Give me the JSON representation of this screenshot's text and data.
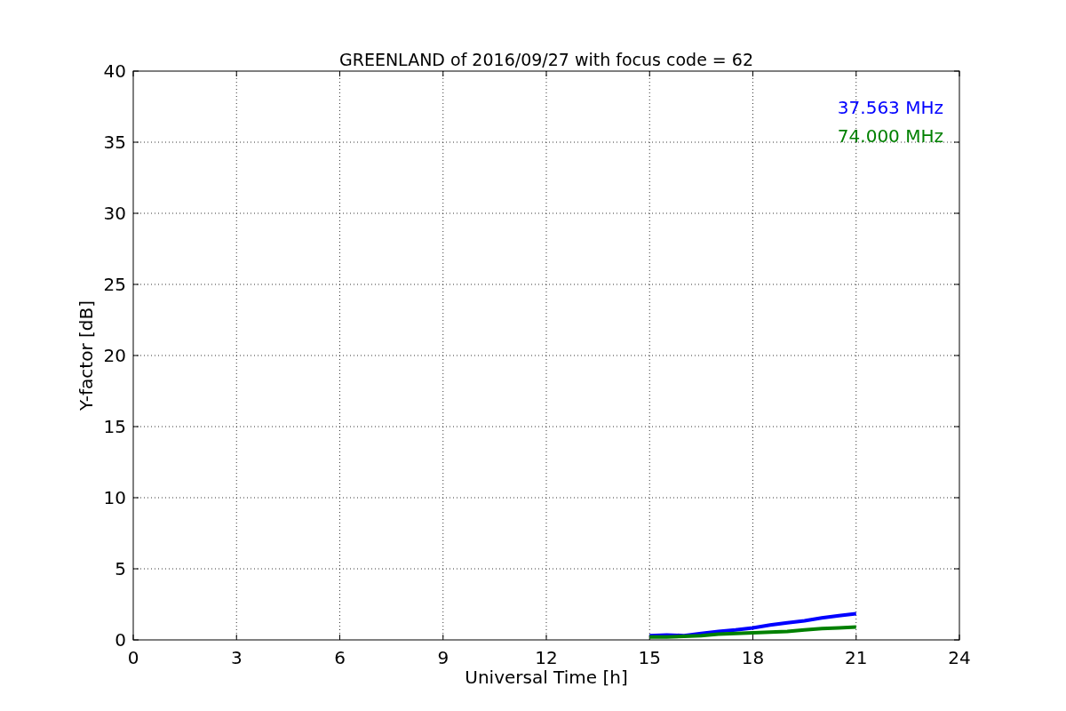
{
  "chart_data": {
    "type": "line",
    "title": "GREENLAND of 2016/09/27 with focus code = 62",
    "xlabel": "Universal Time [h]",
    "ylabel": "Y-factor [dB]",
    "x": [
      15,
      15.5,
      16,
      16.5,
      17,
      17.5,
      18,
      18.5,
      19,
      19.5,
      20,
      20.5,
      21
    ],
    "series": [
      {
        "name": "37.563 MHz",
        "color": "#0000ff",
        "values": [
          0.3,
          0.35,
          0.3,
          0.45,
          0.6,
          0.7,
          0.85,
          1.05,
          1.2,
          1.35,
          1.55,
          1.7,
          1.85
        ]
      },
      {
        "name": "74.000 MHz",
        "color": "#008000",
        "values": [
          0.2,
          0.2,
          0.25,
          0.3,
          0.4,
          0.45,
          0.5,
          0.55,
          0.6,
          0.7,
          0.8,
          0.85,
          0.9
        ]
      }
    ],
    "grid": true,
    "xlim": [
      0,
      24
    ],
    "ylim": [
      0,
      40
    ],
    "xticks": [
      0,
      3,
      6,
      9,
      12,
      15,
      18,
      21,
      24
    ],
    "yticks": [
      0,
      5,
      10,
      15,
      20,
      25,
      30,
      35,
      40
    ]
  }
}
